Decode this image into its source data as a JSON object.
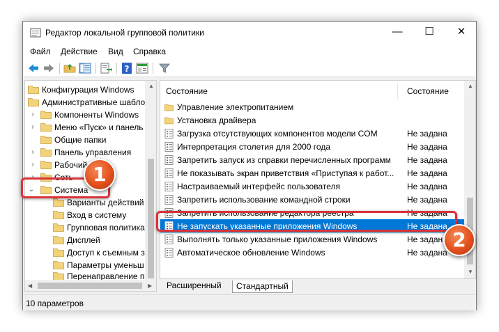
{
  "window": {
    "title": "Редактор локальной групповой политики",
    "controls": {
      "minimize": "—",
      "maximize": "☐",
      "close": "✕"
    }
  },
  "menu": [
    "Файл",
    "Действие",
    "Вид",
    "Справка"
  ],
  "toolbar": {
    "icons": [
      "back-icon",
      "forward-icon",
      "folder-up-icon",
      "show-hide-tree-icon",
      "export-list-icon",
      "help-icon",
      "extended-view-icon",
      "filter-icon"
    ]
  },
  "tree": {
    "items": [
      {
        "label": "Конфигурация Windows"
      },
      {
        "label": "Административные шаблоны"
      },
      {
        "label": "Компоненты Windows"
      },
      {
        "label": "Меню «Пуск» и панель"
      },
      {
        "label": "Общие папки"
      },
      {
        "label": "Панель управления"
      },
      {
        "label": "Рабочий"
      },
      {
        "label": "Сеть"
      },
      {
        "label": "Система"
      },
      {
        "label": "Варианты действий"
      },
      {
        "label": "Вход в систему"
      },
      {
        "label": "Групповая политика"
      },
      {
        "label": "Дисплей"
      },
      {
        "label": "Доступ к съемным з"
      },
      {
        "label": "Параметры уменьш"
      },
      {
        "label": "Перенаправление п"
      }
    ]
  },
  "list": {
    "columns": {
      "name": "Состояние",
      "state": "Состояние"
    },
    "rows": [
      {
        "name": "Управление электропитанием",
        "state": "",
        "type": "folder"
      },
      {
        "name": "Установка драйвера",
        "state": "",
        "type": "folder"
      },
      {
        "name": "Загрузка отсутствующих компонентов модели COM",
        "state": "Не задана",
        "type": "setting"
      },
      {
        "name": "Интерпретация столетия для 2000 года",
        "state": "Не задана",
        "type": "setting"
      },
      {
        "name": "Запретить запуск из справки перечисленных программ",
        "state": "Не задана",
        "type": "setting"
      },
      {
        "name": "Не показывать экран приветствия «Приступая к работ...",
        "state": "Не задана",
        "type": "setting"
      },
      {
        "name": "Настраиваемый интерфейс пользователя",
        "state": "Не задана",
        "type": "setting"
      },
      {
        "name": "Запретить использование командной строки",
        "state": "Не задана",
        "type": "setting"
      },
      {
        "name": "Запретить использование редактора реестра",
        "state": "Не задана",
        "type": "setting"
      },
      {
        "name": "Не запускать указанные приложения Windows",
        "state": "Не задана",
        "type": "setting",
        "selected": true
      },
      {
        "name": "Выполнять только указанные приложения Windows",
        "state": "Не задана",
        "type": "setting"
      },
      {
        "name": "Автоматическое обновление Windows",
        "state": "Не задана",
        "type": "setting"
      }
    ]
  },
  "tabs": [
    "Расширенный",
    "Стандартный"
  ],
  "status": "10 параметров",
  "callouts": [
    "1",
    "2"
  ],
  "colors": {
    "selection": "#0078d7",
    "callout": "#e2501d",
    "frame": "#d9343a"
  }
}
